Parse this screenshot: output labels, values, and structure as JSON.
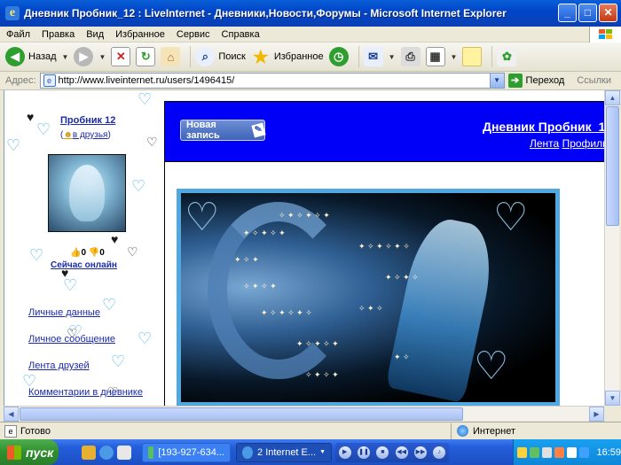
{
  "window": {
    "title": "Дневник Пробник_12 : LiveInternet - Дневники,Новости,Форумы - Microsoft Internet Explorer",
    "minimize": "_",
    "maximize": "□",
    "close": "✕"
  },
  "menu": [
    "Файл",
    "Правка",
    "Вид",
    "Избранное",
    "Сервис",
    "Справка"
  ],
  "toolbar": {
    "back": "Назад",
    "search": "Поиск",
    "favorites": "Избранное"
  },
  "address": {
    "label": "Адрес:",
    "url": "http://www.liveinternet.ru/users/1496415/",
    "go": "Переход",
    "links": "Ссылки"
  },
  "sidebar": {
    "username": "Пробник 12",
    "add_friend": "в друзья",
    "counter_plus": "0",
    "counter_minus": "0",
    "online": "Сейчас онлайн",
    "links": [
      "Личные данные",
      "Личное сообщение",
      "Лента друзей",
      "Комментарии в дневнике"
    ]
  },
  "main": {
    "new_post": "Новая запись",
    "diary_title": "Дневник Пробник_1",
    "tab_feed": "Лента",
    "tab_profile": "Профиль"
  },
  "status": {
    "text": "Готово",
    "zone": "Интернет"
  },
  "taskbar": {
    "start": "пуск",
    "task1": "[193-927-634...",
    "task2": "2 Internet E...",
    "clock": "16:59"
  },
  "colors": {
    "title_blue": "#0046c8",
    "diary_band": "#0000f8",
    "link": "#1a2aa8",
    "image_border": "#4fa8e0"
  }
}
